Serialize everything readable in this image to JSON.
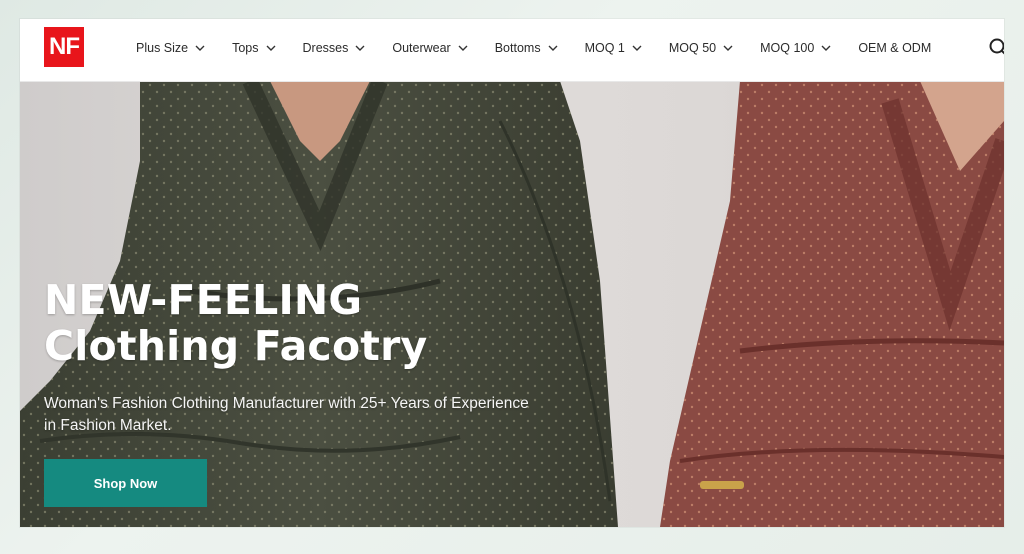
{
  "brand": {
    "logo_text": "NF",
    "logo_color": "#e8151b"
  },
  "nav": {
    "items": [
      {
        "label": "Plus Size",
        "has_dropdown": true
      },
      {
        "label": "Tops",
        "has_dropdown": true
      },
      {
        "label": "Dresses",
        "has_dropdown": true
      },
      {
        "label": "Outerwear",
        "has_dropdown": true
      },
      {
        "label": "Bottoms",
        "has_dropdown": true
      },
      {
        "label": "MOQ 1",
        "has_dropdown": true
      },
      {
        "label": "MOQ 50",
        "has_dropdown": true
      },
      {
        "label": "MOQ 100",
        "has_dropdown": true
      },
      {
        "label": "OEM & ODM",
        "has_dropdown": false
      }
    ],
    "search_icon": "search-icon"
  },
  "hero": {
    "title_line1": "NEW-FEELING",
    "title_line2": "Clothing Facotry",
    "subtitle": "Woman's Fashion Clothing Manufacturer with 25+ Years of Experience in Fashion Market.",
    "cta_label": "Shop Now",
    "cta_color": "#158a80"
  }
}
